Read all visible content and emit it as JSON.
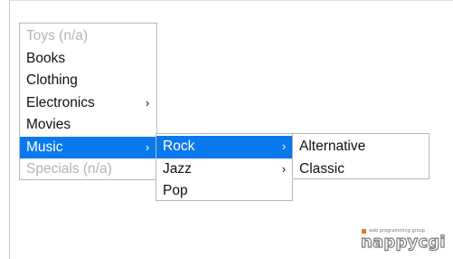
{
  "menu": {
    "main_items": [
      {
        "label": "Toys (n/a)",
        "disabled": true
      },
      {
        "label": "Books"
      },
      {
        "label": "Clothing"
      },
      {
        "label": "Electronics",
        "submenu_arrow": "›"
      },
      {
        "label": "Movies"
      },
      {
        "label": "Music",
        "submenu_arrow": "›",
        "active": true
      },
      {
        "label": "Specials (n/a)",
        "disabled": true
      }
    ],
    "music_items": [
      {
        "label": "Rock",
        "submenu_arrow": "›",
        "active": true
      },
      {
        "label": "Jazz",
        "submenu_arrow": "›"
      },
      {
        "label": "Pop"
      }
    ],
    "rock_items": [
      {
        "label": "Alternative"
      },
      {
        "label": "Classic"
      }
    ]
  },
  "logo": {
    "tagline": "web programming group",
    "word": "nappycgi"
  },
  "colors": {
    "active_bg": "#0a79ee",
    "active_text": "#ffffff",
    "disabled_text": "#b3b3b3",
    "logo_mark": "#e07a1f"
  },
  "icons": {
    "submenu": "chevron-right-icon"
  }
}
